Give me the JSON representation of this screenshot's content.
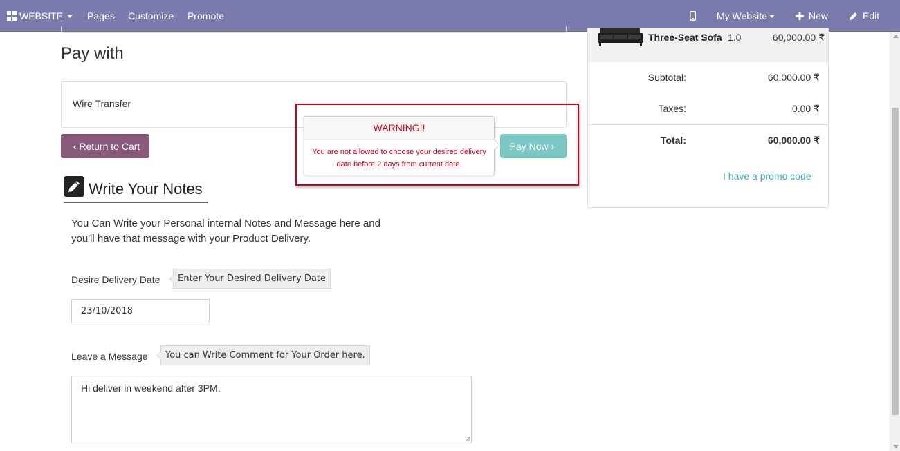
{
  "navbar": {
    "website_label": "WEBSITE",
    "pages_label": "Pages",
    "customize_label": "Customize",
    "promote_label": "Promote",
    "my_website_label": "My Website",
    "new_label": "New",
    "edit_label": "Edit",
    "icons": [
      "grid-icon",
      "mobile-icon",
      "plus-icon",
      "pencil-icon"
    ],
    "background_color": "#7c7bad"
  },
  "payment": {
    "title": "Pay with",
    "method_label": "Wire Transfer",
    "return_label": "Return to Cart",
    "pay_label": "Pay Now",
    "return_color": "#875a7b",
    "pay_color": "#7ac7c3"
  },
  "warning": {
    "title": "WARNING!!",
    "message": "You are not allowed to choose your desired delivery date before 2 days from current date.",
    "color": "#d0021b"
  },
  "notes": {
    "title": "Write Your Notes",
    "description": "You Can Write your Personal internal Notes and Message here and you'll have that message with your Product Delivery.",
    "delivery_date_label": "Desire Delivery Date",
    "delivery_date_hint": "Enter Your Desired Delivery Date",
    "delivery_date_value": "23/10/2018",
    "message_label": "Leave a Message",
    "message_hint": "You can Write Comment for Your Order here.",
    "message_value": "Hi deliver in weekend after 3PM."
  },
  "order_summary": {
    "product": {
      "name": "Three-Seat Sofa",
      "quantity": "1.0",
      "price": "60,000.00 ₹",
      "icon": "sofa-image"
    },
    "subtotal_label": "Subtotal:",
    "subtotal_value": "60,000.00 ₹",
    "taxes_label": "Taxes:",
    "taxes_value": "0.00 ₹",
    "total_label": "Total:",
    "total_value": "60,000.00 ₹",
    "promo_link": "I have a promo code",
    "link_color": "#3aadaa"
  }
}
